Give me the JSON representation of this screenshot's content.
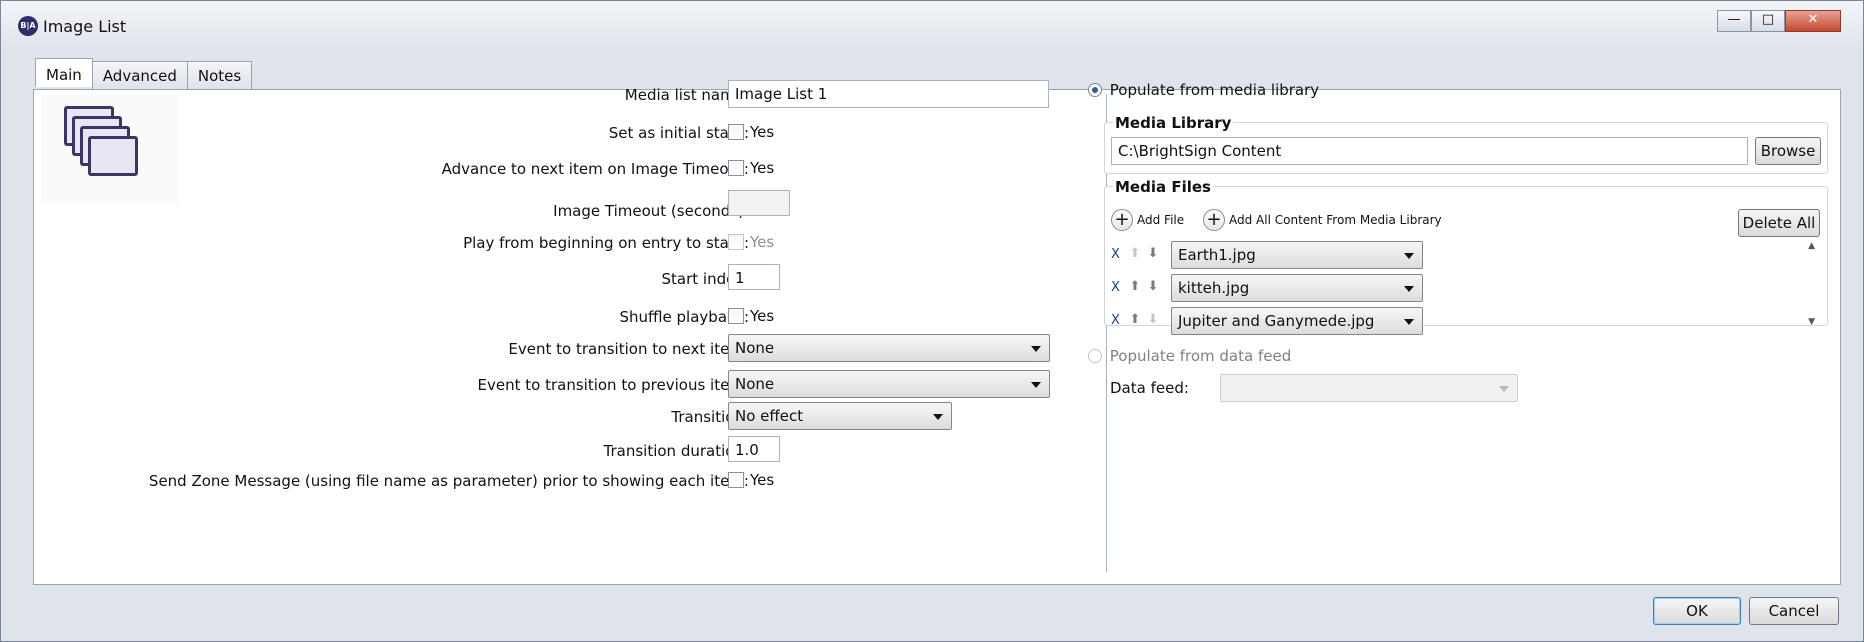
{
  "window": {
    "title": "Image List",
    "app_icon_text": "B|A"
  },
  "tabs": [
    "Main",
    "Advanced",
    "Notes"
  ],
  "fields": {
    "media_list_name": {
      "label": "Media list name:",
      "value": "Image List 1"
    },
    "set_initial": {
      "label": "Set as initial state:",
      "check_label": "Yes",
      "checked": false
    },
    "advance_next": {
      "label": "Advance to next item on Image Timeout:",
      "check_label": "Yes",
      "checked": false
    },
    "image_timeout": {
      "label": "Image Timeout (seconds):",
      "value": ""
    },
    "play_from_beginning": {
      "label": "Play from beginning on entry to state:",
      "check_label": "Yes",
      "checked": false,
      "disabled": true
    },
    "start_index": {
      "label": "Start index:",
      "value": "1"
    },
    "shuffle": {
      "label": "Shuffle playback:",
      "check_label": "Yes",
      "checked": false
    },
    "event_next": {
      "label": "Event to transition to next item:",
      "value": "None"
    },
    "event_prev": {
      "label": "Event to transition to previous item:",
      "value": "None"
    },
    "transition": {
      "label": "Transition:",
      "value": "No effect"
    },
    "transition_duration": {
      "label": "Transition duration:",
      "value": "1.0"
    },
    "send_zone": {
      "label": "Send Zone Message (using file name as parameter) prior to showing each item:",
      "check_label": "Yes",
      "checked": false
    }
  },
  "right": {
    "populate_library": {
      "label": "Populate from media library",
      "selected": true
    },
    "media_library": {
      "group_label": "Media Library",
      "path": "C:\\BrightSign Content",
      "browse_label": "Browse"
    },
    "media_files": {
      "group_label": "Media Files",
      "add_file_label": "Add File",
      "add_all_label": "Add All Content From Media Library",
      "delete_all_label": "Delete All",
      "remove_label": "X",
      "items": [
        "Earth1.jpg",
        "kitteh.jpg",
        "Jupiter and Ganymede.jpg"
      ]
    },
    "populate_feed": {
      "label": "Populate from data feed",
      "selected": false
    },
    "data_feed": {
      "label": "Data feed:",
      "value": ""
    }
  },
  "footer": {
    "ok_label": "OK",
    "cancel_label": "Cancel"
  },
  "icons": {
    "minimize": "minimize-icon",
    "maximize": "maximize-icon",
    "close": "close-icon",
    "up": "arrow-up-icon",
    "down": "arrow-down-icon",
    "add": "plus-icon"
  }
}
